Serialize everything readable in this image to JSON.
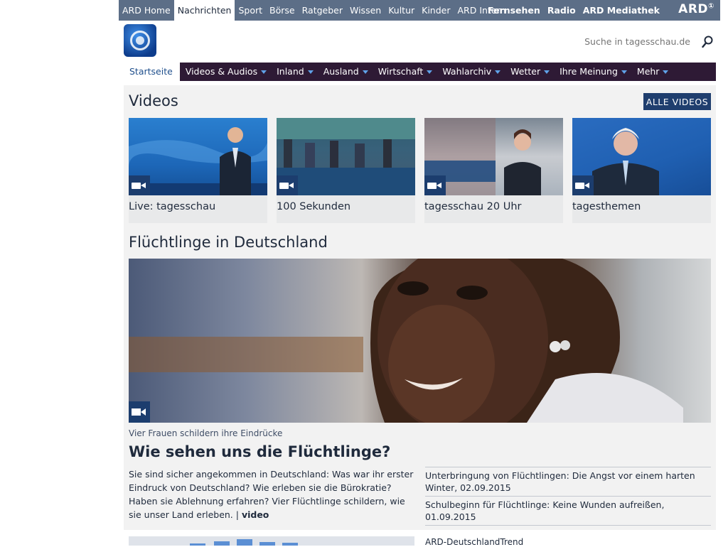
{
  "topbar": {
    "items": [
      "ARD Home",
      "Nachrichten",
      "Sport",
      "Börse",
      "Ratgeber",
      "Wissen",
      "Kultur",
      "Kinder",
      "ARD Intern"
    ],
    "active_index": 1,
    "right_items": [
      "Fernsehen",
      "Radio",
      "ARD Mediathek"
    ],
    "logo_text": "ARD"
  },
  "header": {
    "search_placeholder": "Suche in tagesschau.de"
  },
  "nav": {
    "home": "Startseite",
    "tabs": [
      "Videos & Audios",
      "Inland",
      "Ausland",
      "Wirtschaft",
      "Wahlarchiv",
      "Wetter",
      "Ihre Meinung",
      "Mehr"
    ]
  },
  "videos": {
    "heading": "Videos",
    "all_label": "ALLE VIDEOS",
    "items": [
      {
        "title": "Live: tagesschau"
      },
      {
        "title": "100 Sekunden"
      },
      {
        "title": "tagesschau 20 Uhr"
      },
      {
        "title": "tagesthemen"
      }
    ]
  },
  "feature": {
    "heading": "Flüchtlinge in Deutschland",
    "kicker": "Vier Frauen schildern ihre Eindrücke",
    "headline": "Wie sehen uns die Flüchtlinge?",
    "teaser": "Sie sind sicher angekommen in Deutschland: Was war ihr erster Eindruck von Deutschland? Wie erleben sie die Bürokratie? Haben sie Ablehnung erfahren? Vier Flüchtlinge schildern, wie sie unser Land erleben. |",
    "teaser_link": "video",
    "related": [
      "Unterbringung von Flüchtlingen: Die Angst vor einem harten Winter, 02.09.2015",
      "Schulbeginn für Flüchtlinge: Keine Wunden aufreißen, 01.09.2015"
    ]
  },
  "bottom": {
    "label": "ARD-DeutschlandTrend"
  }
}
